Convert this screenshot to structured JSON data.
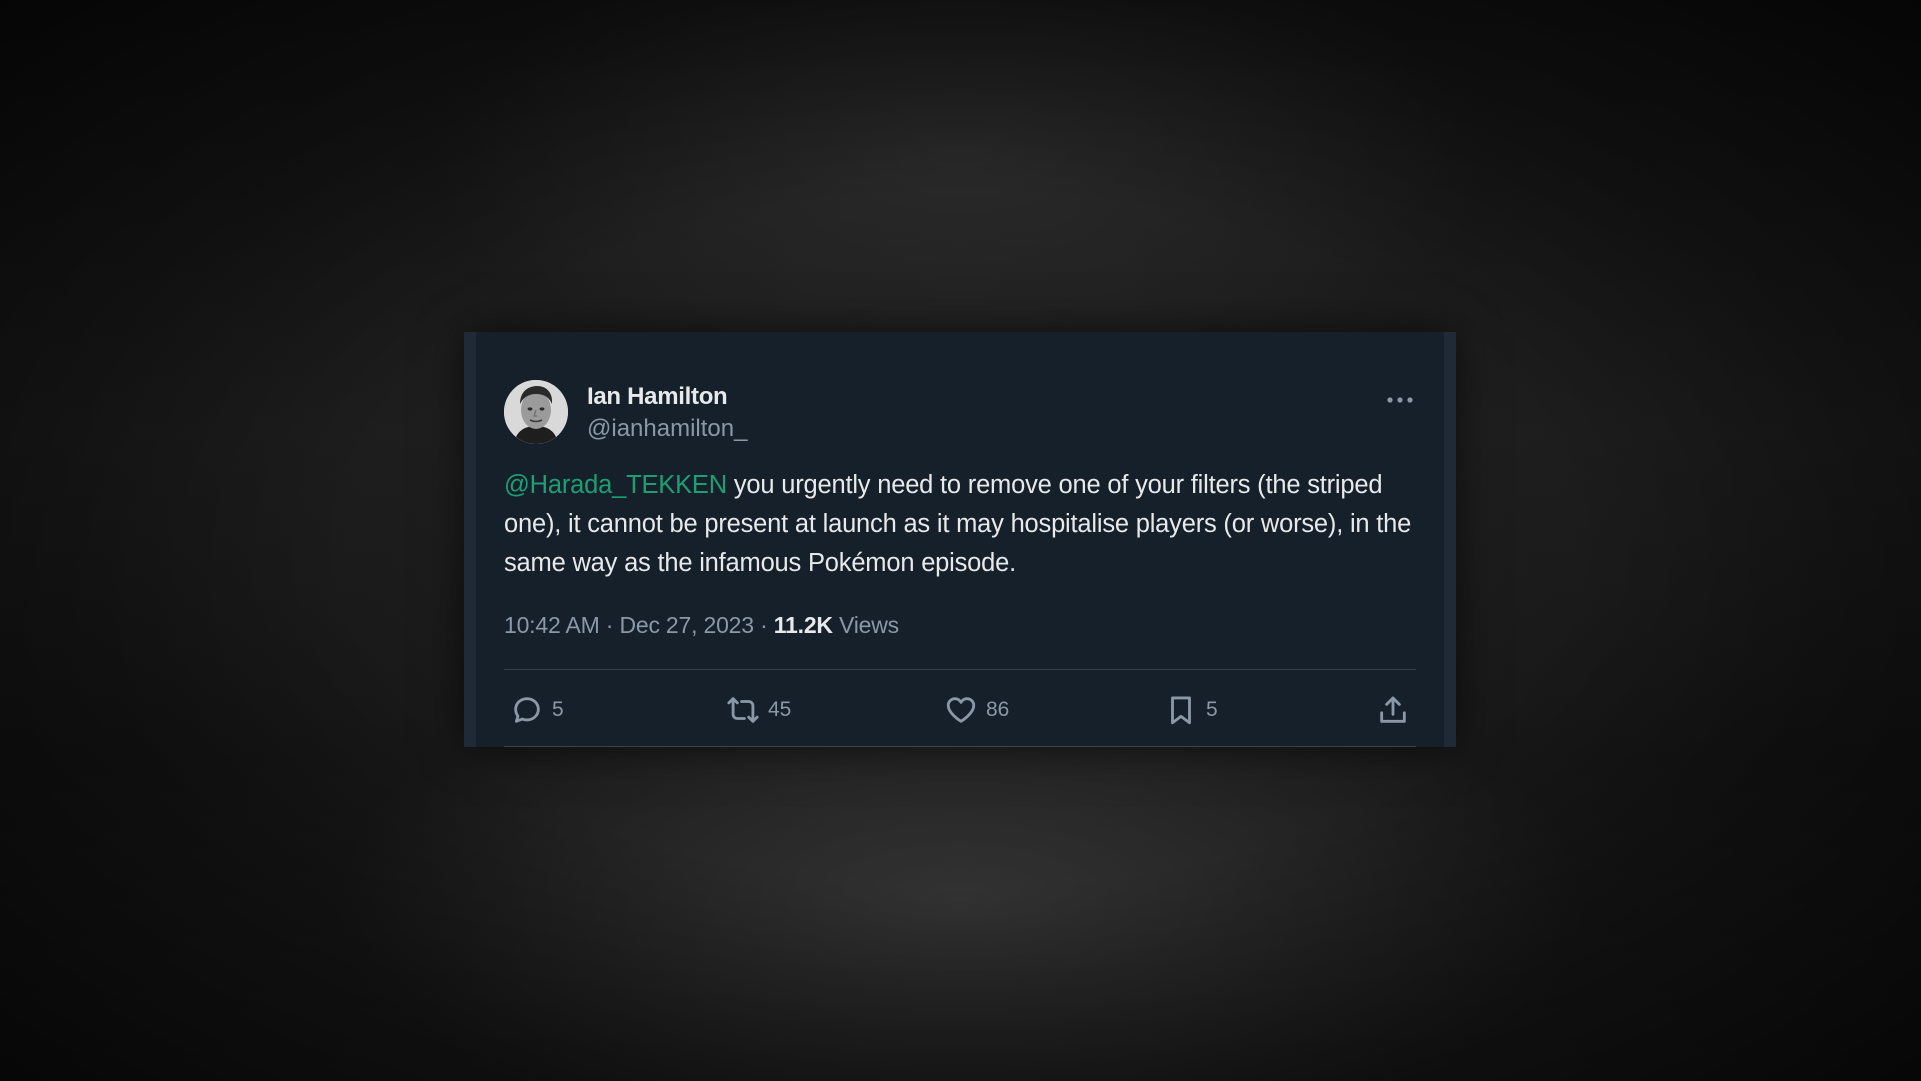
{
  "tweet": {
    "display_name": "Ian Hamilton",
    "handle": "@ianhamilton_",
    "mention": "@Harada_TEKKEN",
    "body": " you urgently need to remove one of your filters (the striped one), it cannot be present at launch as it may hospitalise players (or worse), in the same way as the infamous Pokémon episode.",
    "time": "10:42 AM",
    "date": "Dec 27, 2023",
    "views_count": "11.2K",
    "views_label": "Views",
    "replies": "5",
    "reposts": "45",
    "likes": "86",
    "bookmarks": "5"
  },
  "icons": {
    "more": "more-horizontal-icon",
    "reply": "reply-icon",
    "repost": "repost-icon",
    "like": "heart-icon",
    "bookmark": "bookmark-icon",
    "share": "share-icon"
  },
  "colors": {
    "card_background": "#15202b",
    "mention": "#1d9e73",
    "primary_text": "#e7e9ea",
    "secondary_text": "#8b98a5"
  }
}
